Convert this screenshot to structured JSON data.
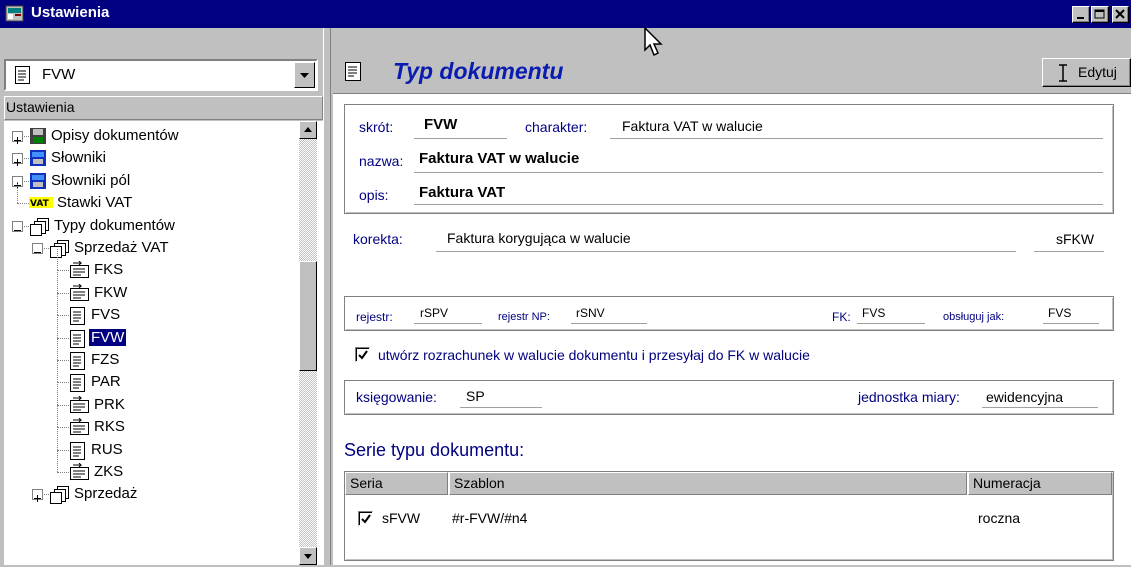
{
  "window": {
    "title": "Ustawienia"
  },
  "left": {
    "combo_value": "FVW",
    "tree_header": "Ustawienia",
    "tree": [
      {
        "label": "Opisy dokumentów",
        "icon": "save-disk-icon",
        "expander": "+"
      },
      {
        "label": "Słowniki",
        "icon": "blue-dictionary-icon",
        "expander": "+"
      },
      {
        "label": "Słowniki pól",
        "icon": "blue-dictionary-icon",
        "expander": "+"
      },
      {
        "label": "Stawki VAT",
        "icon": "vat-icon",
        "icon_text": "VAT"
      },
      {
        "label": "Typy dokumentów",
        "icon": "stacked-pages-icon",
        "expander": "-"
      },
      {
        "label": "Sprzedaż VAT",
        "icon": "stacked-pages-icon",
        "expander": "-"
      },
      {
        "label": "FKS",
        "icon": "correction-document-icon"
      },
      {
        "label": "FKW",
        "icon": "correction-document-icon"
      },
      {
        "label": "FVS",
        "icon": "document-icon"
      },
      {
        "label": "FVW",
        "icon": "document-icon",
        "selected": true
      },
      {
        "label": "FZS",
        "icon": "document-icon"
      },
      {
        "label": "PAR",
        "icon": "document-icon"
      },
      {
        "label": "PRK",
        "icon": "correction-document-icon"
      },
      {
        "label": "RKS",
        "icon": "correction-document-icon"
      },
      {
        "label": "RUS",
        "icon": "document-icon"
      },
      {
        "label": "ZKS",
        "icon": "correction-document-icon"
      },
      {
        "label": "Sprzedaż",
        "icon": "stacked-pages-icon",
        "expander": "+"
      }
    ]
  },
  "header": {
    "title": "Typ dokumentu",
    "edit_label": "Edytuj"
  },
  "doc": {
    "skrot_label": "skrót:",
    "skrot": "FVW",
    "charakter_label": "charakter:",
    "charakter": "Faktura VAT w walucie",
    "nazwa_label": "nazwa:",
    "nazwa": "Faktura VAT w walucie",
    "opis_label": "opis:",
    "opis": "Faktura VAT",
    "korekta_label": "korekta:",
    "korekta": "Faktura korygująca w walucie",
    "korekta_code": "sFKW",
    "rejestr_label": "rejestr:",
    "rejestr": "rSPV",
    "rejestr_np_label": "rejestr NP:",
    "rejestr_np": "rSNV",
    "fk_label": "FK:",
    "fk": "FVS",
    "obsluguj_label": "obsługuj jak:",
    "obsluguj": "FVS",
    "checkbox_label": "utwórz rozrachunek w walucie dokumentu i przesyłaj do FK w walucie",
    "checkbox_checked": true,
    "ksiegowanie_label": "księgowanie:",
    "ksiegowanie": "SP",
    "jednostka_label": "jednostka miary:",
    "jednostka": "ewidencyjna"
  },
  "series": {
    "title": "Serie typu dokumentu:",
    "columns": [
      "Seria",
      "Szablon",
      "Numeracja"
    ],
    "rows": [
      {
        "seria": "sFVW",
        "szablon": "#r-FVW/#n4",
        "numeracja": "roczna",
        "checked": true
      }
    ]
  }
}
